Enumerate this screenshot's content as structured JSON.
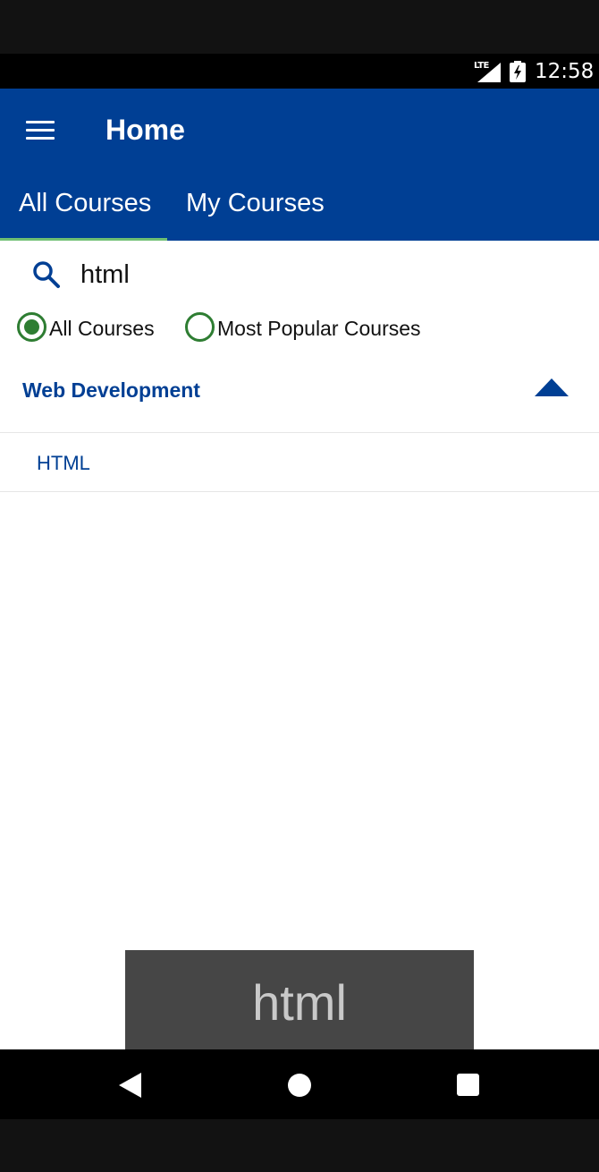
{
  "status_bar": {
    "network": "LTE",
    "time": "12:58"
  },
  "app_bar": {
    "title": "Home"
  },
  "tabs": [
    {
      "label": "All Courses",
      "selected": true
    },
    {
      "label": "My Courses",
      "selected": false
    }
  ],
  "search": {
    "value": "html",
    "placeholder": ""
  },
  "filters": [
    {
      "label": "All Courses",
      "selected": true
    },
    {
      "label": "Most Popular Courses",
      "selected": false
    }
  ],
  "category": {
    "title": "Web Development",
    "expanded": true,
    "items": [
      {
        "label": "HTML"
      }
    ]
  },
  "toast": {
    "text": "html"
  },
  "icons": {
    "menu": "hamburger-menu-icon",
    "search": "search-icon",
    "collapse": "triangle-up-icon",
    "back": "nav-back-icon",
    "home": "nav-home-icon",
    "recents": "nav-recents-icon"
  },
  "colors": {
    "primary": "#003f94",
    "accent_green": "#2e7d32",
    "tab_indicator": "#6fbf73",
    "toast_bg": "#464646"
  }
}
